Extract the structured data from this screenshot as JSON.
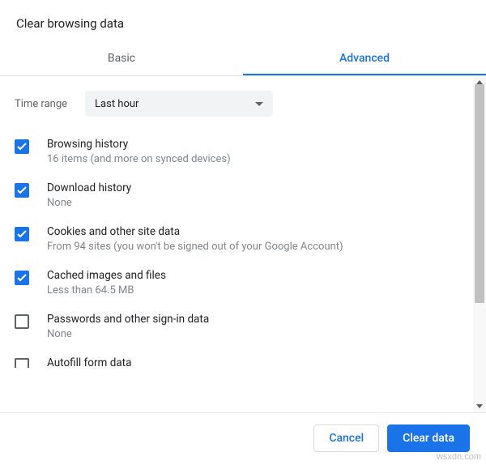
{
  "dialog": {
    "title": "Clear browsing data"
  },
  "tabs": {
    "basic": "Basic",
    "advanced": "Advanced",
    "active": "advanced"
  },
  "timeRange": {
    "label": "Time range",
    "value": "Last hour"
  },
  "items": [
    {
      "checked": true,
      "title": "Browsing history",
      "sub": "16 items (and more on synced devices)"
    },
    {
      "checked": true,
      "title": "Download history",
      "sub": "None"
    },
    {
      "checked": true,
      "title": "Cookies and other site data",
      "sub": "From 94 sites (you won't be signed out of your Google Account)"
    },
    {
      "checked": true,
      "title": "Cached images and files",
      "sub": "Less than 64.5 MB"
    },
    {
      "checked": false,
      "title": "Passwords and other sign-in data",
      "sub": "None"
    },
    {
      "checked": false,
      "title": "Autofill form data",
      "sub": ""
    }
  ],
  "footer": {
    "cancel": "Cancel",
    "confirm": "Clear data"
  },
  "watermark": "wsxdn.com"
}
